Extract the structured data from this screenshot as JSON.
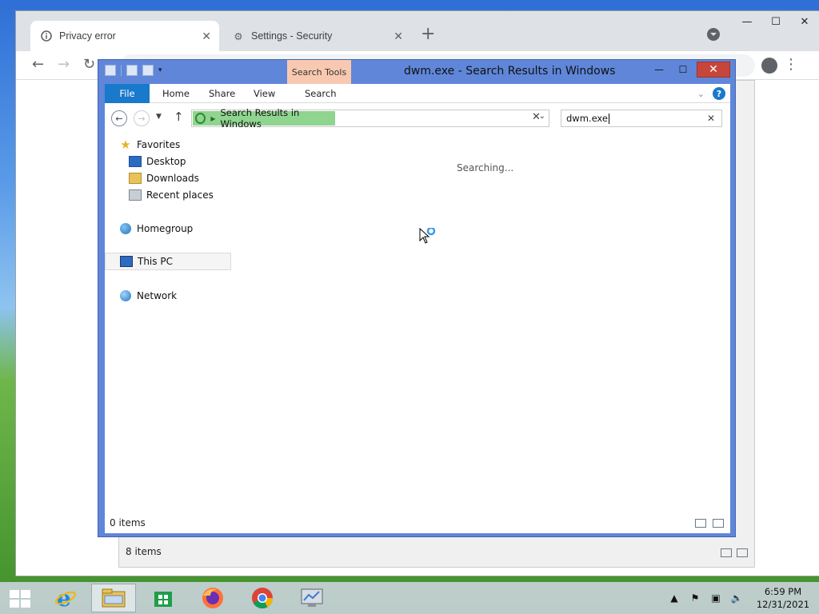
{
  "browser": {
    "tabs": [
      {
        "label": "Privacy error",
        "icon": "info-icon"
      },
      {
        "label": "Settings - Security",
        "icon": "gear-icon"
      }
    ],
    "new_tab_label": "+",
    "window_controls": [
      "minimize",
      "maximize",
      "close"
    ]
  },
  "settings_window": {
    "status": "8 items"
  },
  "explorer": {
    "title": "dwm.exe - Search Results in Windows",
    "context_tab": "Search Tools",
    "ribbon_tabs": [
      "File",
      "Home",
      "Share",
      "View",
      "Search"
    ],
    "address": "Search Results in Windows",
    "search_value": "dwm.exe",
    "searching_text": "Searching...",
    "nav": {
      "favorites": "Favorites",
      "desktop": "Desktop",
      "downloads": "Downloads",
      "recent": "Recent places",
      "homegroup": "Homegroup",
      "this_pc": "This PC",
      "network": "Network"
    },
    "status": "0 items"
  },
  "taskbar": {
    "time": "6:59 PM",
    "date": "12/31/2021",
    "apps": [
      "internet-explorer",
      "file-explorer",
      "store",
      "firefox",
      "chrome",
      "control-panel"
    ]
  },
  "colors": {
    "explorer_frame": "#5f86d9",
    "file_tab": "#1979ca",
    "search_tools_tab": "#f8c9b0",
    "close_button": "#c7463b",
    "address_highlight": "#8fd48f"
  }
}
